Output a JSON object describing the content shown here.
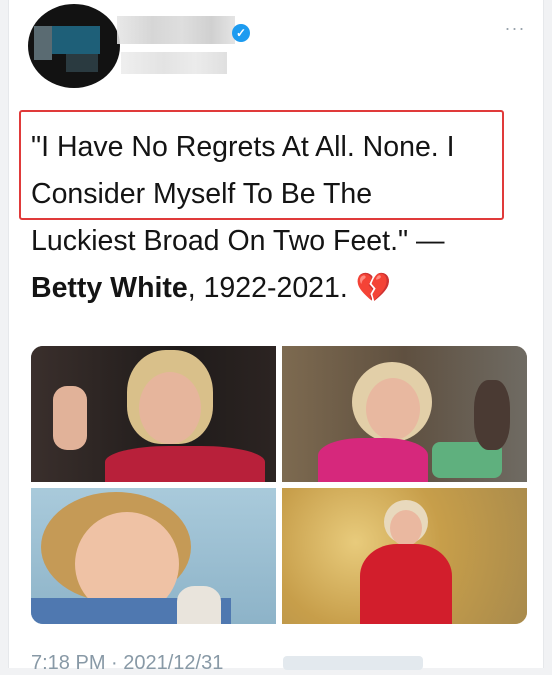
{
  "tweet": {
    "author": {
      "verified_icon": "verified-badge-icon",
      "avatar_redacted": true,
      "name_redacted": true,
      "handle_redacted": true
    },
    "more_icon": "more-options-icon",
    "more_glyph": "···",
    "verified_glyph": "✓",
    "text_lines": [
      "\"I Have No Regrets At All. None. I",
      "Consider Myself To Be The",
      "Luckiest Broad On Two Feet.\" —"
    ],
    "attribution_name": "Betty White",
    "attribution_rest": ", 1922-2021. ",
    "emoji": "💔",
    "photo_count": 4,
    "timestamp": "7:18 PM · 2021/12/31"
  },
  "colors": {
    "highlight_border": "#e03a3a",
    "verified": "#1d9bf0",
    "text": "#141414",
    "meta": "#8899a6"
  }
}
